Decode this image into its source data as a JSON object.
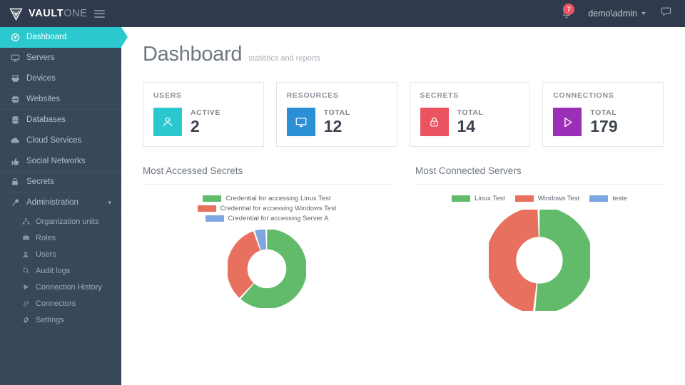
{
  "brand": {
    "name_bold": "VAULT",
    "name_light": "ONE",
    "logo_icon": "shield-vault-icon",
    "menu_icon": "hamburger-icon"
  },
  "topbar": {
    "notifications": {
      "icon": "bell-icon",
      "count": "7"
    },
    "user": {
      "name": "demo\\admin",
      "caret_icon": "chevron-down-icon"
    },
    "chat": {
      "icon": "chat-bubble-icon"
    }
  },
  "sidebar": {
    "items": [
      {
        "label": "Dashboard",
        "icon": "dashboard-gauge-icon",
        "active": true
      },
      {
        "label": "Servers",
        "icon": "monitor-icon",
        "active": false
      },
      {
        "label": "Devices",
        "icon": "printer-icon",
        "active": false
      },
      {
        "label": "Websites",
        "icon": "globe-icon",
        "active": false
      },
      {
        "label": "Databases",
        "icon": "database-icon",
        "active": false
      },
      {
        "label": "Cloud Services",
        "icon": "cloud-icon",
        "active": false
      },
      {
        "label": "Social Networks",
        "icon": "thumbs-up-icon",
        "active": false
      },
      {
        "label": "Secrets",
        "icon": "lock-icon",
        "active": false
      },
      {
        "label": "Administration",
        "icon": "wrench-icon",
        "active": false,
        "expandable": true,
        "chevron_icon": "chevron-down-icon"
      }
    ],
    "sub_items": [
      {
        "label": "Organization units",
        "icon": "sitemap-icon"
      },
      {
        "label": "Roles",
        "icon": "briefcase-icon"
      },
      {
        "label": "Users",
        "icon": "user-icon"
      },
      {
        "label": "Audit logs",
        "icon": "search-icon"
      },
      {
        "label": "Connection History",
        "icon": "play-icon"
      },
      {
        "label": "Connectors",
        "icon": "link-icon"
      },
      {
        "label": "Settings",
        "icon": "gear-icon"
      }
    ]
  },
  "page": {
    "title": "Dashboard",
    "subtitle": "statistics and reports"
  },
  "cards": [
    {
      "title": "USERS",
      "label": "ACTIVE",
      "value": "2",
      "icon": "user-icon",
      "color": "#2BC9CF"
    },
    {
      "title": "RESOURCES",
      "label": "TOTAL",
      "value": "12",
      "icon": "monitor-icon",
      "color": "#2A8FD4"
    },
    {
      "title": "SECRETS",
      "label": "TOTAL",
      "value": "14",
      "icon": "lock-icon",
      "color": "#EA5460"
    },
    {
      "title": "CONNECTIONS",
      "label": "TOTAL",
      "value": "179",
      "icon": "play-icon",
      "color": "#9B2FB5"
    }
  ],
  "chart_data": [
    {
      "type": "pie",
      "title": "Most Accessed Secrets",
      "legend_position": "top",
      "categories": [
        "Credential for accessing Linux Test",
        "Credential for accessing Windows Test",
        "Credential for accessing Server A"
      ],
      "values": [
        62,
        33,
        5
      ],
      "colors": [
        "#62BB6A",
        "#E8705F",
        "#7EA6E0"
      ],
      "xlabel": "",
      "ylabel": ""
    },
    {
      "type": "pie",
      "title": "Most Connected Servers",
      "legend_position": "top",
      "categories": [
        "Linux Test",
        "Windows Test",
        "teste"
      ],
      "values": [
        52,
        48,
        0
      ],
      "colors": [
        "#62BB6A",
        "#E8705F",
        "#7EA6E0"
      ],
      "xlabel": "",
      "ylabel": ""
    }
  ]
}
